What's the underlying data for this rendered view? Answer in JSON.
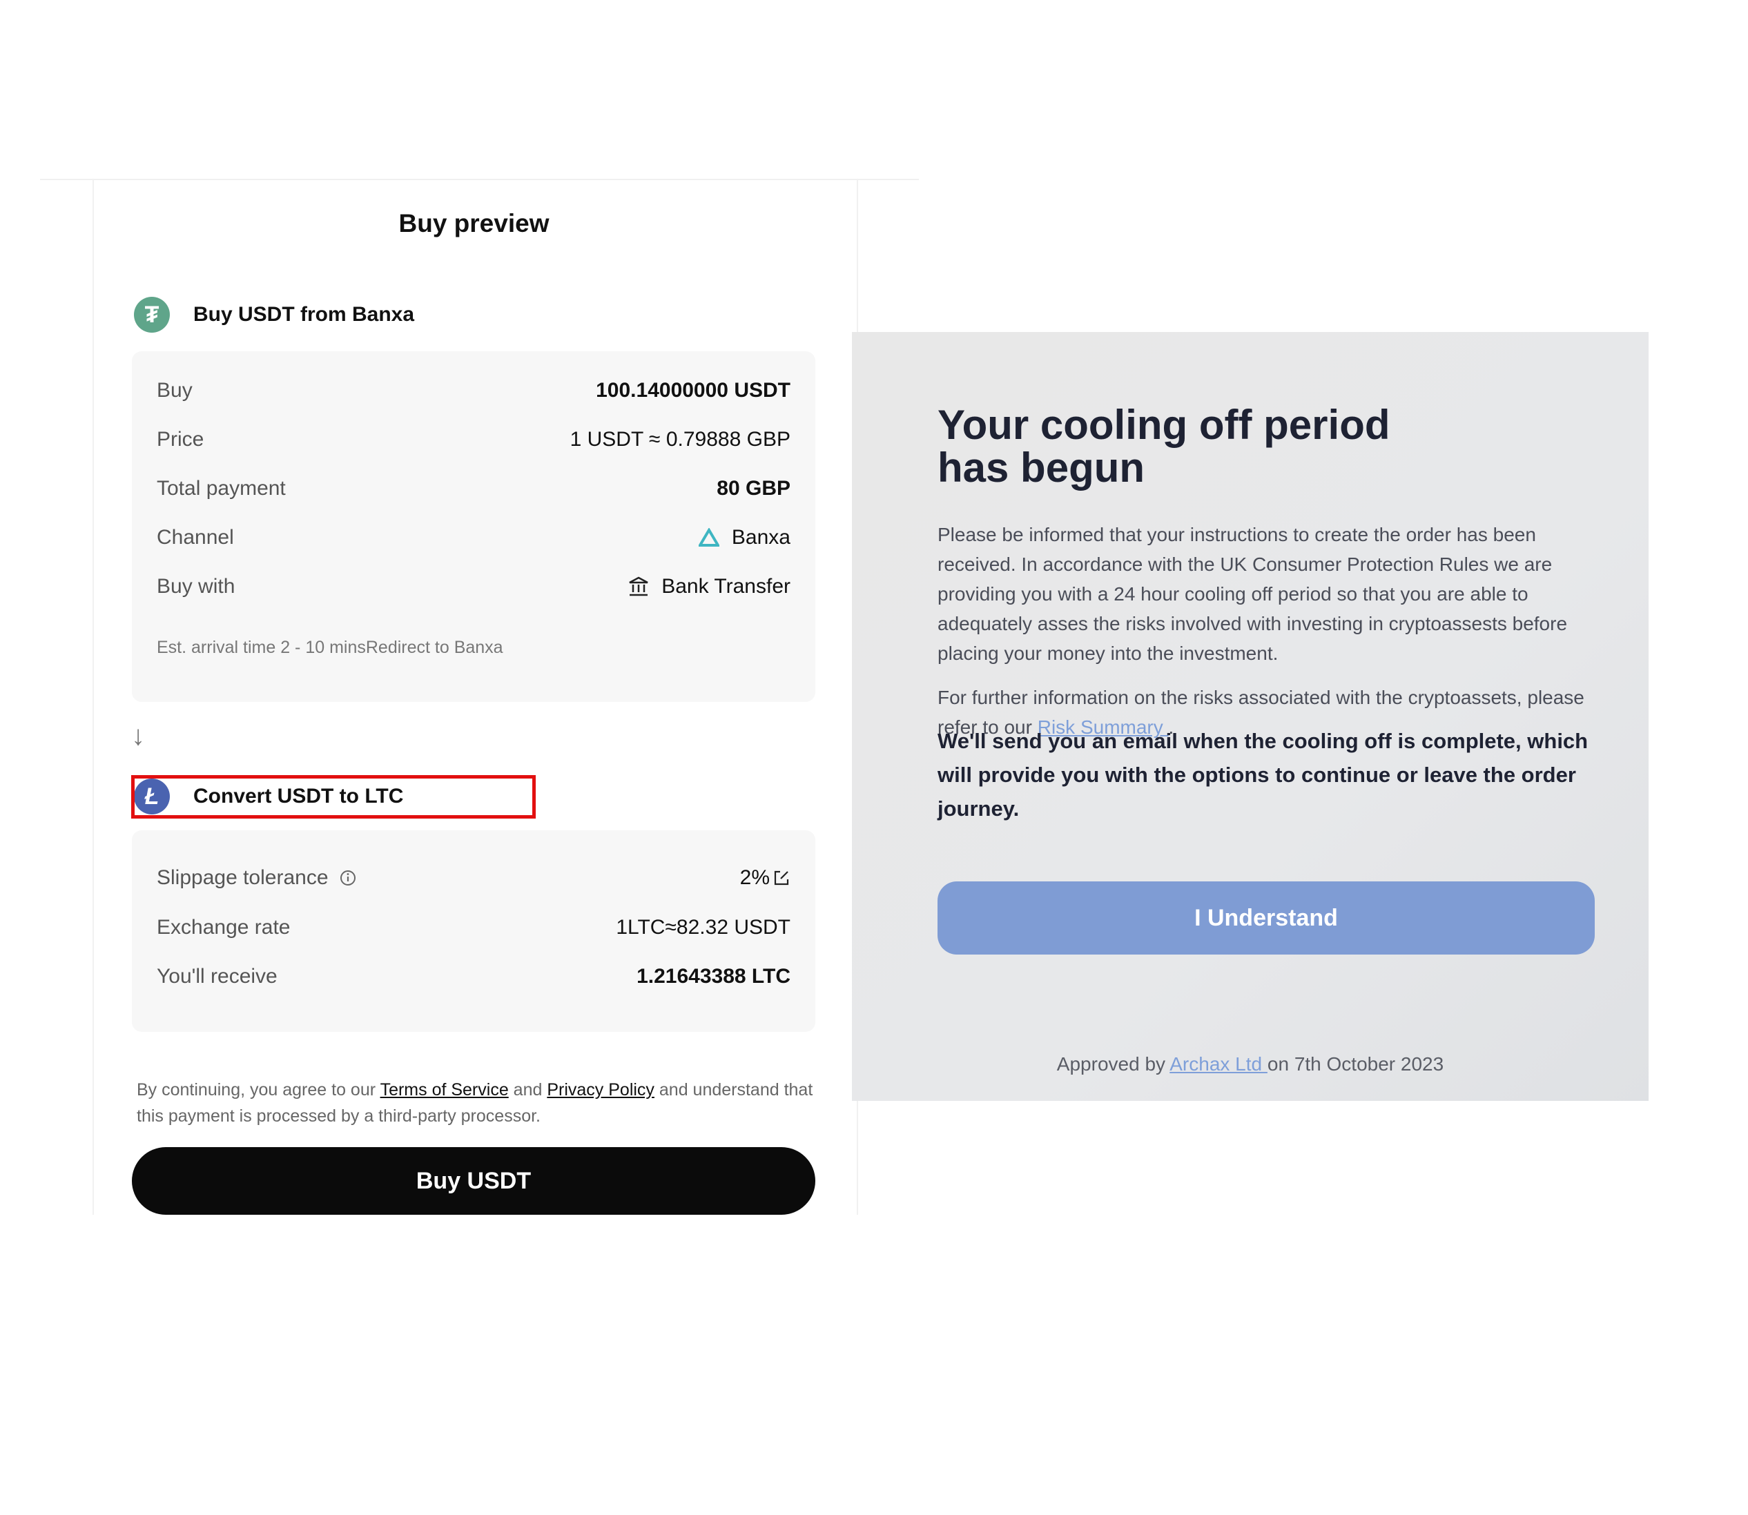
{
  "buy_preview": {
    "title": "Buy preview",
    "section1_label": "Buy USDT from Banxa",
    "rows": [
      {
        "label": "Buy",
        "value": "100.14000000 USDT"
      },
      {
        "label": "Price",
        "value": "1 USDT ≈ 0.79888 GBP"
      },
      {
        "label": "Total payment",
        "value": "80 GBP"
      },
      {
        "label": "Channel",
        "value": "Banxa"
      },
      {
        "label": "Buy with",
        "value": "Bank Transfer"
      }
    ],
    "arrival_note": "Est. arrival time 2 - 10 minsRedirect to Banxa",
    "down_arrow": "↓",
    "section2_label": "Convert USDT to LTC",
    "rows2": [
      {
        "label": "Slippage tolerance",
        "value": "2%"
      },
      {
        "label": "Exchange rate",
        "value": "1LTC≈82.32 USDT"
      },
      {
        "label": "You'll receive",
        "value": "1.21643388 LTC"
      }
    ],
    "legal": {
      "part1": "By continuing, you agree to our ",
      "terms": "Terms of Service",
      "and": " and ",
      "privacy": "Privacy Policy",
      "part2": " and understand that this payment is processed by a third-party processor."
    },
    "buy_button": "Buy USDT",
    "usdt_icon_glyph": "₮",
    "ltc_icon_glyph": "Ł",
    "colors": {
      "usdt": "#5fa58a",
      "ltc": "#4a63b0",
      "highlight": "#e21010",
      "buy_button": "#0b0b0b"
    }
  },
  "cooling": {
    "title_line1": "Your cooling off period",
    "title_line2": "has begun",
    "para1": "Please be informed that your instructions to create the order has been received. In accordance with the UK Consumer Protection Rules we are providing you with a 24 hour cooling off period so that you are able to adequately asses the risks involved with investing in cryptoassests before placing your money into the investment.",
    "para2_prefix": "For further information on the risks associated with the cryptoassets, please refer to our ",
    "para2_link": "Risk Summary ",
    "para2_suffix": ".",
    "para3": "We'll send you an email when the cooling off is complete, which will provide you with the options to continue or leave the order journey.",
    "button": "I Understand",
    "approved_prefix": "Approved by ",
    "approved_link": "Archax Ltd ",
    "approved_suffix": "on 7th October 2023",
    "colors": {
      "button": "#7f9cd4",
      "link": "#7e9fd9"
    }
  }
}
